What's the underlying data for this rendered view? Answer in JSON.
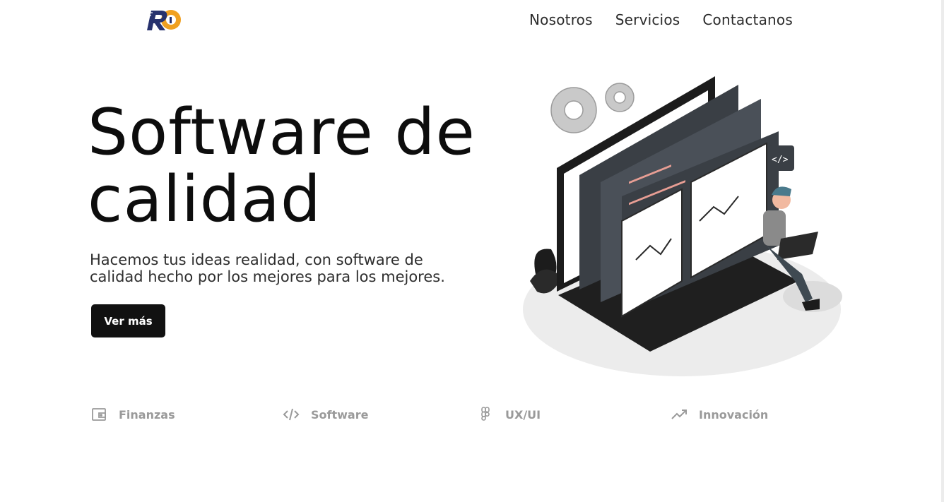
{
  "nav": {
    "items": [
      "Nosotros",
      "Servicios",
      "Contactanos"
    ]
  },
  "hero": {
    "title_line1": "Software de",
    "title_line2": "calidad",
    "subtitle_line1": "Hacemos tus ideas realidad, con software de",
    "subtitle_line2": "calidad hecho por los mejores para los mejores.",
    "cta_label": "Ver más"
  },
  "features": [
    {
      "label": "Finanzas",
      "icon": "wallet-icon"
    },
    {
      "label": "Software",
      "icon": "code-icon"
    },
    {
      "label": "UX/UI",
      "icon": "figma-icon"
    },
    {
      "label": "Innovación",
      "icon": "trending-up-icon"
    }
  ],
  "colors": {
    "brand_navy": "#27326e",
    "brand_orange": "#f0a020",
    "text_dark": "#111111",
    "muted": "#9a9a9a"
  }
}
